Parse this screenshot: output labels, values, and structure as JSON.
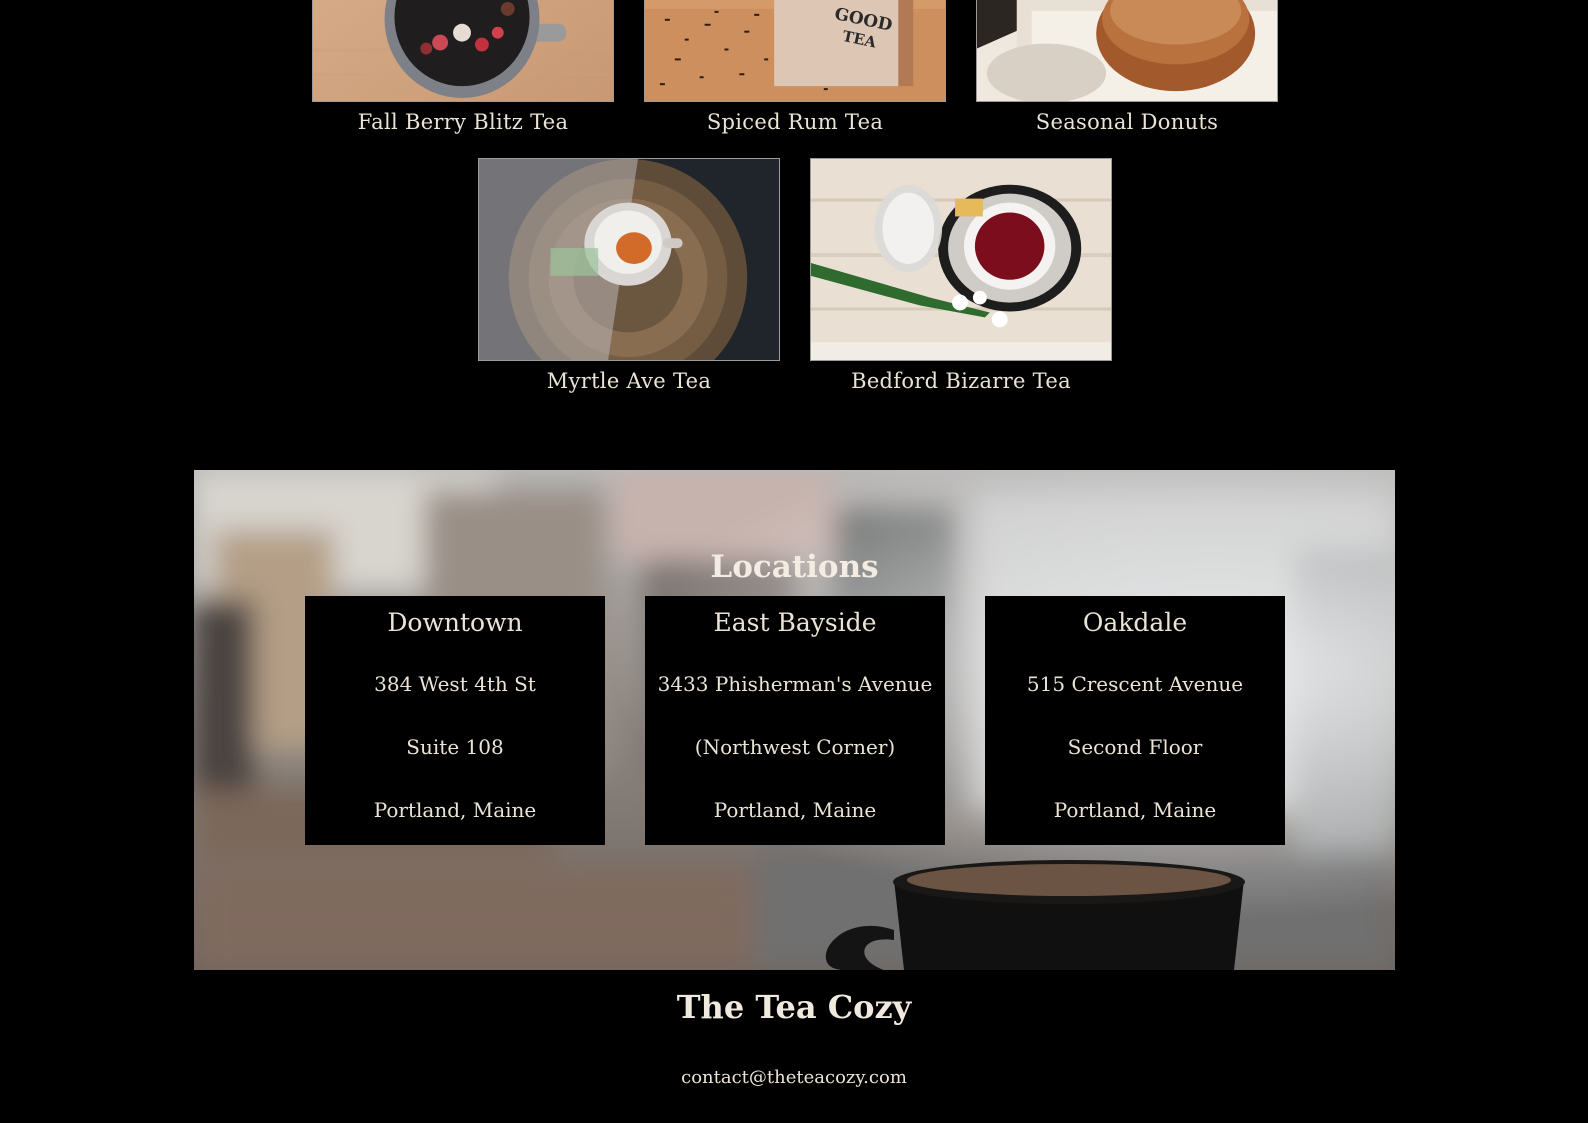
{
  "menu": {
    "items": [
      {
        "name": "Fall Berry Blitz Tea"
      },
      {
        "name": "Spiced Rum Tea",
        "image_text": [
          "GOOD",
          "TEA"
        ]
      },
      {
        "name": "Seasonal Donuts"
      },
      {
        "name": "Myrtle Ave Tea"
      },
      {
        "name": "Bedford Bizarre Tea"
      }
    ]
  },
  "locations": {
    "title": "Locations",
    "cards": [
      {
        "name": "Downtown",
        "line1": "384 West 4th St",
        "line2": "Suite 108",
        "line3": "Portland, Maine"
      },
      {
        "name": "East Bayside",
        "line1": "3433 Phisherman's Avenue",
        "line2": "(Northwest Corner)",
        "line3": "Portland, Maine"
      },
      {
        "name": "Oakdale",
        "line1": "515 Crescent Avenue",
        "line2": "Second Floor",
        "line3": "Portland, Maine"
      }
    ]
  },
  "footer": {
    "brand": "The Tea Cozy",
    "contact": "contact@theteacozy.com"
  },
  "colors": {
    "background": "#000000",
    "text": "#eae3d6",
    "tile_border": "#9b9b9b"
  }
}
